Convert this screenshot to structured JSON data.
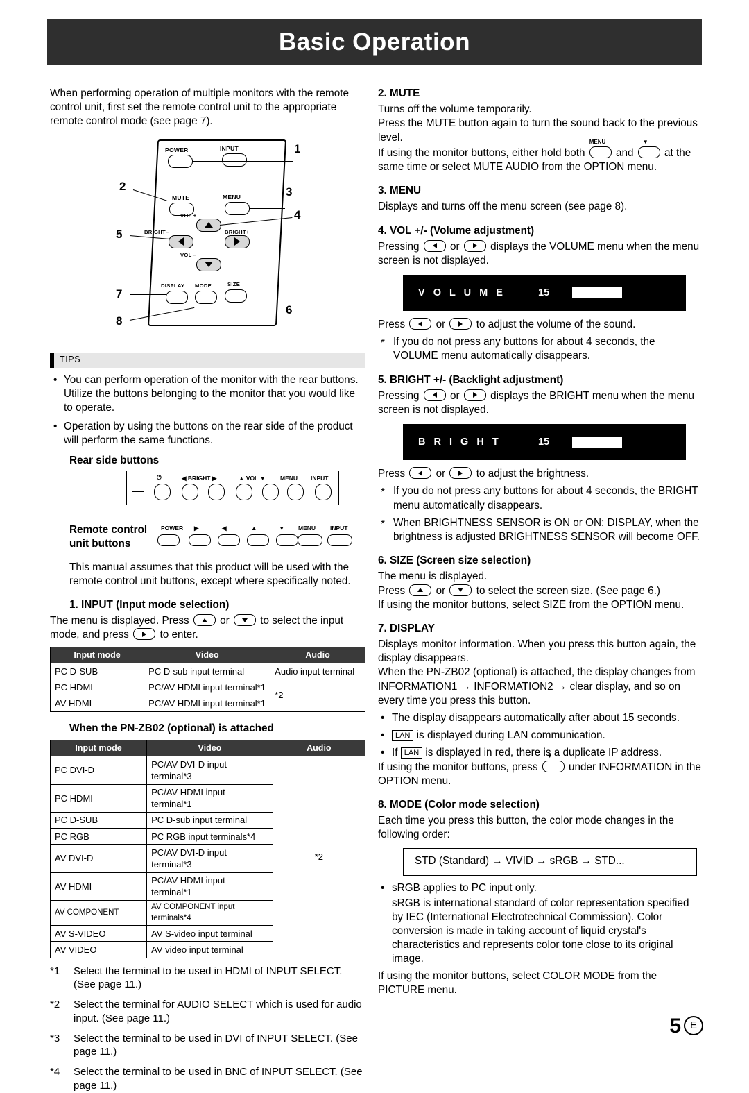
{
  "header": {
    "title": "Basic Operation"
  },
  "left": {
    "intro": "When performing operation of multiple monitors with the remote control unit, first set the remote control unit to the appropriate remote control mode (see page 7).",
    "remote": {
      "buttons": {
        "power": "POWER",
        "input": "INPUT",
        "mute": "MUTE",
        "menu": "MENU",
        "vol_plus": "VOL +",
        "vol_minus": "VOL –",
        "bright_minus": "BRIGHT–",
        "bright_plus": "BRIGHT+",
        "display": "DISPLAY",
        "mode": "MODE",
        "size": "SIZE"
      },
      "callouts": [
        "1",
        "2",
        "3",
        "4",
        "5",
        "6",
        "7",
        "8"
      ]
    },
    "tips_label": "TIPS",
    "tips": [
      "You can perform operation of the monitor with the rear buttons. Utilize the buttons belonging to the monitor that you would like to operate.",
      "Operation by using the buttons on the rear side of the product will perform the same functions."
    ],
    "rear_side_heading": "Rear side buttons",
    "remote_unit_heading_line1": "Remote control",
    "remote_unit_heading_line2": "unit buttons",
    "rear_labels": {
      "bright": "BRIGHT",
      "vol": "VOL",
      "menu": "MENU",
      "input": "INPUT",
      "power": "POWER"
    },
    "manual_note": "This manual assumes that this product will be used with the remote control unit buttons, except where specifically noted.",
    "input_section": {
      "title": "1. INPUT (Input mode selection)",
      "text_a": "The menu is displayed. Press",
      "text_or": "or",
      "text_b": "to select the input mode, and press",
      "text_c": "to enter."
    },
    "table1": {
      "headers": [
        "Input mode",
        "Video",
        "Audio"
      ],
      "rows": [
        [
          "PC D-SUB",
          "PC D-sub input terminal",
          "Audio input terminal"
        ],
        [
          "PC HDMI",
          "PC/AV HDMI input terminal*1",
          "*2"
        ],
        [
          "AV HDMI",
          "PC/AV HDMI input terminal*1",
          ""
        ]
      ]
    },
    "zb02_heading": "When the PN-ZB02 (optional) is attached",
    "table2": {
      "headers": [
        "Input mode",
        "Video",
        "Audio"
      ],
      "rows": [
        [
          "PC DVI-D",
          "PC/AV DVI-D input terminal*3",
          "*2"
        ],
        [
          "PC HDMI",
          "PC/AV HDMI input terminal*1",
          ""
        ],
        [
          "PC D-SUB",
          "PC D-sub input terminal",
          ""
        ],
        [
          "PC RGB",
          "PC RGB input terminals*4",
          ""
        ],
        [
          "AV DVI-D",
          "PC/AV DVI-D input terminal*3",
          ""
        ],
        [
          "AV HDMI",
          "PC/AV HDMI input terminal*1",
          ""
        ],
        [
          "AV COMPONENT",
          "AV COMPONENT input terminals*4",
          ""
        ],
        [
          "AV S-VIDEO",
          "AV S-video input terminal",
          ""
        ],
        [
          "AV VIDEO",
          "AV video input terminal",
          ""
        ]
      ]
    },
    "footnotes": [
      {
        "mark": "*1",
        "text": "Select the terminal to be used in HDMI of INPUT SELECT. (See page 11.)"
      },
      {
        "mark": "*2",
        "text": "Select the terminal for AUDIO SELECT which is used for audio input. (See page 11.)"
      },
      {
        "mark": "*3",
        "text": "Select the terminal to be used in DVI of INPUT SELECT. (See page 11.)"
      },
      {
        "mark": "*4",
        "text": "Select the terminal to be used in BNC of INPUT SELECT. (See page 11.)"
      }
    ]
  },
  "right": {
    "mute": {
      "title": "2. MUTE",
      "p1": "Turns off the volume temporarily.",
      "p2": "Press the MUTE button again to turn the sound back to the previous level.",
      "p3a": "If using the monitor buttons, either hold both",
      "p3b": "and",
      "p3c": "at the same time or select MUTE AUDIO from the OPTION menu.",
      "menu_cap": "MENU"
    },
    "menu": {
      "title": "3. MENU",
      "p1": "Displays and turns off the menu screen (see page 8)."
    },
    "vol": {
      "title": "4. VOL +/- (Volume adjustment)",
      "p1a": "Pressing",
      "p1or": "or",
      "p1b": "displays the VOLUME menu when the menu screen is not displayed.",
      "osd_name": "V O L U M E",
      "osd_value": "15",
      "p2a": "Press",
      "p2b": "to adjust the volume of the sound.",
      "note": "If you do not press any buttons for about 4 seconds, the VOLUME menu automatically disappears."
    },
    "bright": {
      "title": "5. BRIGHT +/- (Backlight adjustment)",
      "p1a": "Pressing",
      "p1b": "displays the BRIGHT menu when the menu screen is not displayed.",
      "osd_name": "B R I G H T",
      "osd_value": "15",
      "p2a": "Press",
      "p2b": "to adjust the brightness.",
      "note1": "If you do not press any buttons for about 4 seconds, the BRIGHT menu automatically disappears.",
      "note2": "When BRIGHTNESS SENSOR is ON or ON: DISPLAY, when the brightness is adjusted BRIGHTNESS SENSOR will become OFF."
    },
    "size": {
      "title": "6. SIZE (Screen size selection)",
      "p1": "The menu is displayed.",
      "p2a": "Press",
      "p2b": "to select the screen size. (See page 6.)",
      "p3": "If using the monitor buttons, select SIZE from the OPTION menu."
    },
    "display": {
      "title": "7. DISPLAY",
      "p1": "Displays monitor information. When you press this button again, the display disappears.",
      "p2": "When the PN-ZB02 (optional) is attached, the display changes from INFORMATION1 → INFORMATION2 → clear display, and so on every time you press this button.",
      "b1": "The display disappears automatically after about 15 seconds.",
      "b2a": "is displayed during LAN communication.",
      "b3a": "If",
      "b3b": "is displayed in red, there is a duplicate IP address.",
      "lan_chip": "LAN",
      "p3a": "If using the monitor buttons, press",
      "p3b": "under INFORMATION in the OPTION menu."
    },
    "mode": {
      "title": "8. MODE (Color mode selection)",
      "p1": "Each time you press this button, the color mode changes in the following order:",
      "order": "STD (Standard) → VIVID → sRGB → STD...",
      "b1": "sRGB applies to PC input only.",
      "b2": "sRGB is international standard of color representation specified by IEC (International Electrotechnical Commission). Color conversion is made in taking account of liquid crystal's characteristics and represents color tone close to its original image.",
      "p2": "If using the monitor buttons, select COLOR MODE from the PICTURE menu."
    }
  },
  "footer": {
    "page": "5",
    "edition": "E"
  }
}
